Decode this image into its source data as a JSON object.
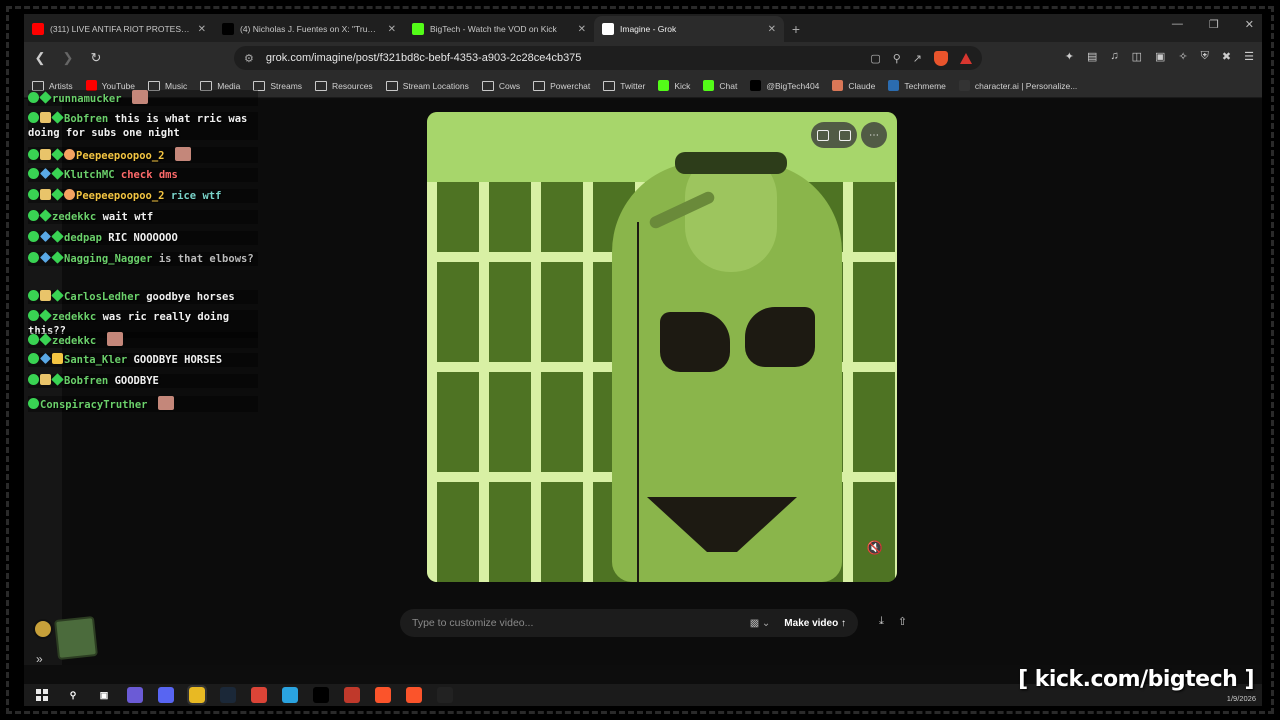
{
  "tabs": [
    {
      "title": "(311) LIVE ANTIFA RIOT PROTEST ANTI-ICE",
      "icon": "youtube-icon",
      "color": "#ff0000",
      "active": false
    },
    {
      "title": "(4) Nicholas J. Fuentes on X: \"Trump needs to",
      "icon": "x-icon",
      "color": "#000000",
      "active": false
    },
    {
      "title": "BigTech - Watch the VOD on Kick",
      "icon": "kick-icon",
      "color": "#53fc18",
      "active": false
    },
    {
      "title": "Imagine - Grok",
      "icon": "grok-icon",
      "color": "#ffffff",
      "active": true
    }
  ],
  "toolbar": {
    "url": "grok.com/imagine/post/f321bd8c-bebf-4353-a903-2c28ce4cb375"
  },
  "bookmarks": [
    {
      "label": "Artists",
      "icon": "folder-icon"
    },
    {
      "label": "YouTube",
      "icon": "youtube-icon"
    },
    {
      "label": "Music",
      "icon": "folder-icon"
    },
    {
      "label": "Media",
      "icon": "folder-icon"
    },
    {
      "label": "Streams",
      "icon": "folder-icon"
    },
    {
      "label": "Resources",
      "icon": "folder-icon"
    },
    {
      "label": "Stream Locations",
      "icon": "folder-icon"
    },
    {
      "label": "Cows",
      "icon": "folder-icon"
    },
    {
      "label": "Powerchat",
      "icon": "folder-icon"
    },
    {
      "label": "Twitter",
      "icon": "folder-icon"
    },
    {
      "label": "Kick",
      "icon": "kick-icon"
    },
    {
      "label": "Chat",
      "icon": "kick-icon"
    },
    {
      "label": "@BigTech404",
      "icon": "x-icon"
    },
    {
      "label": "Claude",
      "icon": "claude-icon"
    },
    {
      "label": "Techmeme",
      "icon": "techmeme-icon"
    },
    {
      "label": "character.ai | Personalize...",
      "icon": "characterai-icon"
    }
  ],
  "prompt": {
    "placeholder": "Type to customize video...",
    "make_label": "Make video"
  },
  "chat": [
    {
      "user": "runnamucker",
      "msg": "",
      "color": "#6bd06b",
      "badges": [
        "green",
        "diamond"
      ],
      "emote": true
    },
    {
      "user": "Bobfren",
      "msg": "this is what rric was doing for subs one night",
      "color": "#6bd06b",
      "badges": [
        "green",
        "gift",
        "diamond"
      ],
      "emote": false
    },
    {
      "user": "Peepeepoopoo_2",
      "msg": "",
      "color": "#f4c542",
      "badges": [
        "green",
        "gift",
        "diamond",
        "one"
      ],
      "emote": true
    },
    {
      "user": "KlutchMC",
      "msg": "check dms",
      "color": "#6bd06b",
      "badges": [
        "green",
        "sword",
        "diamond"
      ],
      "emote": false,
      "msg_color": "#ff6b6b"
    },
    {
      "user": "Peepeepoopoo_2",
      "msg": "rice wtf",
      "color": "#f4c542",
      "badges": [
        "green",
        "gift",
        "diamond",
        "one"
      ],
      "emote": false,
      "msg_color": "#7ad3c9"
    },
    {
      "user": "zedekkc",
      "msg": "wait wtf",
      "color": "#6bd06b",
      "badges": [
        "green",
        "diamond"
      ],
      "emote": false
    },
    {
      "user": "dedpap",
      "msg": "RIC NOOOOOO",
      "color": "#6bd06b",
      "badges": [
        "green",
        "sword",
        "diamond"
      ],
      "emote": false
    },
    {
      "user": "Nagging_Nagger",
      "msg": "is that elbows?",
      "color": "#6bd06b",
      "badges": [
        "green",
        "sword",
        "diamond"
      ],
      "emote": false,
      "msg_color": "#bbbbbb"
    },
    {
      "user": "CarlosLedher",
      "msg": "goodbye horses",
      "color": "#6bd06b",
      "badges": [
        "green",
        "gift",
        "diamond"
      ],
      "emote": false
    },
    {
      "user": "zedekkc",
      "msg": "was ric really doing this??",
      "color": "#6bd06b",
      "badges": [
        "green",
        "diamond"
      ],
      "emote": false
    },
    {
      "user": "zedekkc",
      "msg": "",
      "color": "#6bd06b",
      "badges": [
        "green",
        "diamond"
      ],
      "emote": true
    },
    {
      "user": "Santa_Kler",
      "msg": "GOODBYE HORSES",
      "color": "#6bd06b",
      "badges": [
        "green",
        "sword",
        "crown"
      ],
      "emote": false
    },
    {
      "user": "Bobfren",
      "msg": "GOODBYE",
      "color": "#6bd06b",
      "badges": [
        "green",
        "gift",
        "diamond"
      ],
      "emote": false
    },
    {
      "user": "ConspiracyTruther",
      "msg": "",
      "color": "#6bd06b",
      "badges": [
        "green"
      ],
      "emote": true
    }
  ],
  "overlay": {
    "kick_url": "[ kick.com/bigtech ]",
    "date": "1/9/2026"
  },
  "taskbar": [
    "windows-icon",
    "search-icon",
    "task-view-icon",
    "copilot-icon",
    "discord-icon",
    "file-explorer-icon",
    "steam-icon",
    "chrome-icon",
    "telegram-icon",
    "x-icon",
    "voicemeeter-icon",
    "brave-icon",
    "brave-icon",
    "grok-icon"
  ]
}
